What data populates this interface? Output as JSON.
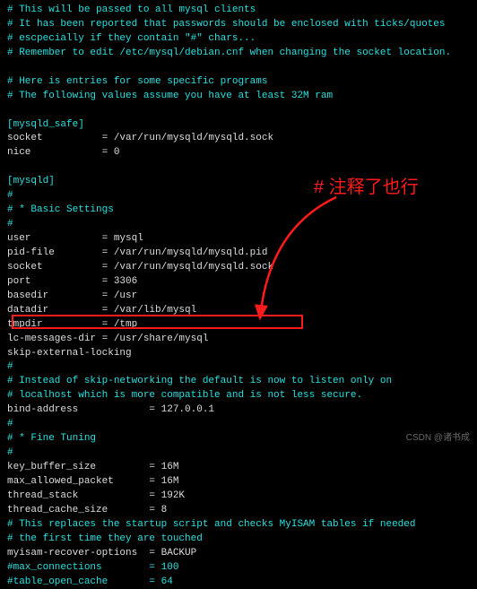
{
  "comments": {
    "c1": "# This will be passed to all mysql clients",
    "c2": "# It has been reported that passwords should be enclosed with ticks/quotes",
    "c3": "# escpecially if they contain \"#\" chars...",
    "c4": "# Remember to edit /etc/mysql/debian.cnf when changing the socket location.",
    "c5": "# Here is entries for some specific programs",
    "c6": "# The following values assume you have at least 32M ram",
    "c7": "#",
    "c8": "# * Basic Settings",
    "c9": "#",
    "c10": "#",
    "c11": "# Instead of skip-networking the default is now to listen only on",
    "c12": "# localhost which is more compatible and is not less secure.",
    "c13": "#",
    "c14": "# * Fine Tuning",
    "c15": "#",
    "c16": "# This replaces the startup script and checks MyISAM tables if needed",
    "c17": "# the first time they are touched",
    "c18": "#max_connections        = 100",
    "c19": "#table_open_cache       = 64"
  },
  "sections": {
    "mysqld_safe": "[mysqld_safe]",
    "mysqld": "[mysqld]"
  },
  "settings": {
    "safe_socket": "socket          = /var/run/mysqld/mysqld.sock",
    "safe_nice": "nice            = 0",
    "user": "user            = mysql",
    "pid_file": "pid-file        = /var/run/mysqld/mysqld.pid",
    "socket": "socket          = /var/run/mysqld/mysqld.sock",
    "port": "port            = 3306",
    "basedir": "basedir         = /usr",
    "datadir": "datadir         = /var/lib/mysql",
    "tmpdir": "tmpdir          = /tmp",
    "lc_messages": "lc-messages-dir = /usr/share/mysql",
    "skip_ext": "skip-external-locking",
    "bind_address": "bind-address            = 127.0.0.1",
    "key_buffer": "key_buffer_size         = 16M",
    "max_allowed": "max_allowed_packet      = 16M",
    "thread_stack": "thread_stack            = 192K",
    "thread_cache": "thread_cache_size       = 8",
    "myisam": "myisam-recover-options  = BACKUP"
  },
  "annotation_label": "# 注释了也行",
  "watermark": "CSDN @诸书成"
}
